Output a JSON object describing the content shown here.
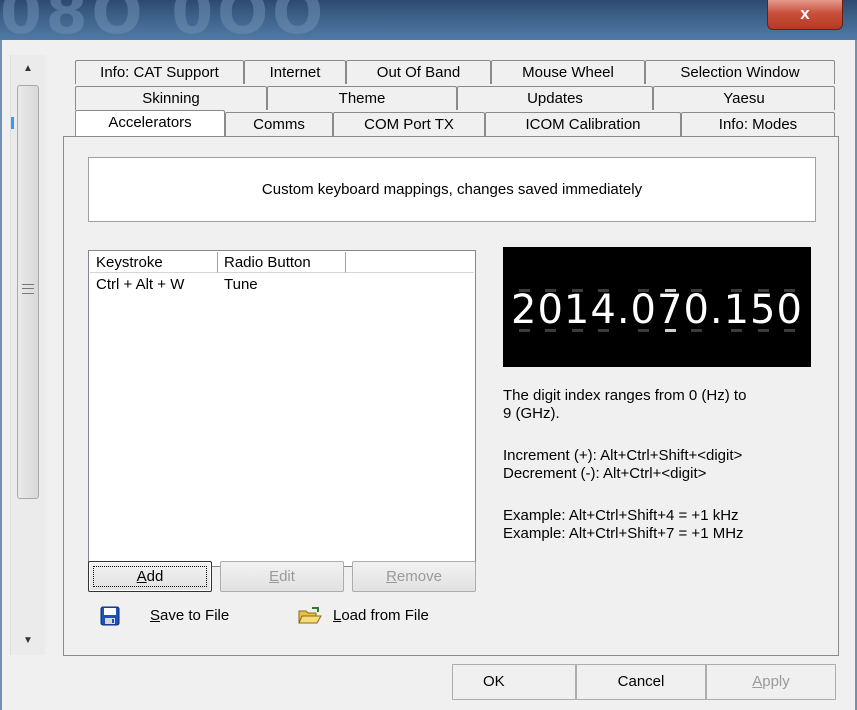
{
  "window": {
    "close_label": "x"
  },
  "tabs": {
    "row1": [
      "Info: CAT Support",
      "Internet",
      "Out Of Band",
      "Mouse Wheel",
      "Selection Window"
    ],
    "row2": [
      "Skinning",
      "Theme",
      "Updates",
      "Yaesu"
    ],
    "row3": [
      "Accelerators",
      "Comms",
      "COM Port TX",
      "ICOM Calibration",
      "Info: Modes"
    ],
    "selected": "Accelerators"
  },
  "description": "Custom keyboard mappings, changes saved immediately",
  "mappings": {
    "columns": [
      "Keystroke",
      "Radio Button"
    ],
    "rows": [
      {
        "keystroke": "Ctrl + Alt + W",
        "radio_button": "Tune"
      }
    ]
  },
  "buttons": {
    "add": {
      "pre": "",
      "key": "A",
      "post": "dd"
    },
    "edit": {
      "pre": "",
      "key": "E",
      "post": "dit"
    },
    "remove": {
      "pre": "",
      "key": "R",
      "post": "emove"
    }
  },
  "file_actions": {
    "save": {
      "pre": "",
      "key": "S",
      "post": "ave to File",
      "icon": "floppy-disk-icon"
    },
    "load": {
      "pre": "",
      "key": "L",
      "post": "oad from File",
      "icon": "open-folder-icon"
    }
  },
  "frequency_display": {
    "value": "2014.070.150",
    "background": "#000000",
    "digit_color": "#ffffff",
    "highlighted_digit_index": 5
  },
  "help": {
    "line1": "The digit index ranges from 0 (Hz) to",
    "line2": "9 (GHz).",
    "increment": "Increment (+):  Alt+Ctrl+Shift+<digit>",
    "decrement": "Decrement (-):  Alt+Ctrl+<digit>",
    "example1": "Example:  Alt+Ctrl+Shift+4  =  +1 kHz",
    "example2": "Example:  Alt+Ctrl+Shift+7  =  +1 MHz"
  },
  "dialog_buttons": {
    "ok": "OK",
    "cancel": "Cancel",
    "apply": {
      "pre": "",
      "key": "A",
      "post": "pply"
    }
  }
}
